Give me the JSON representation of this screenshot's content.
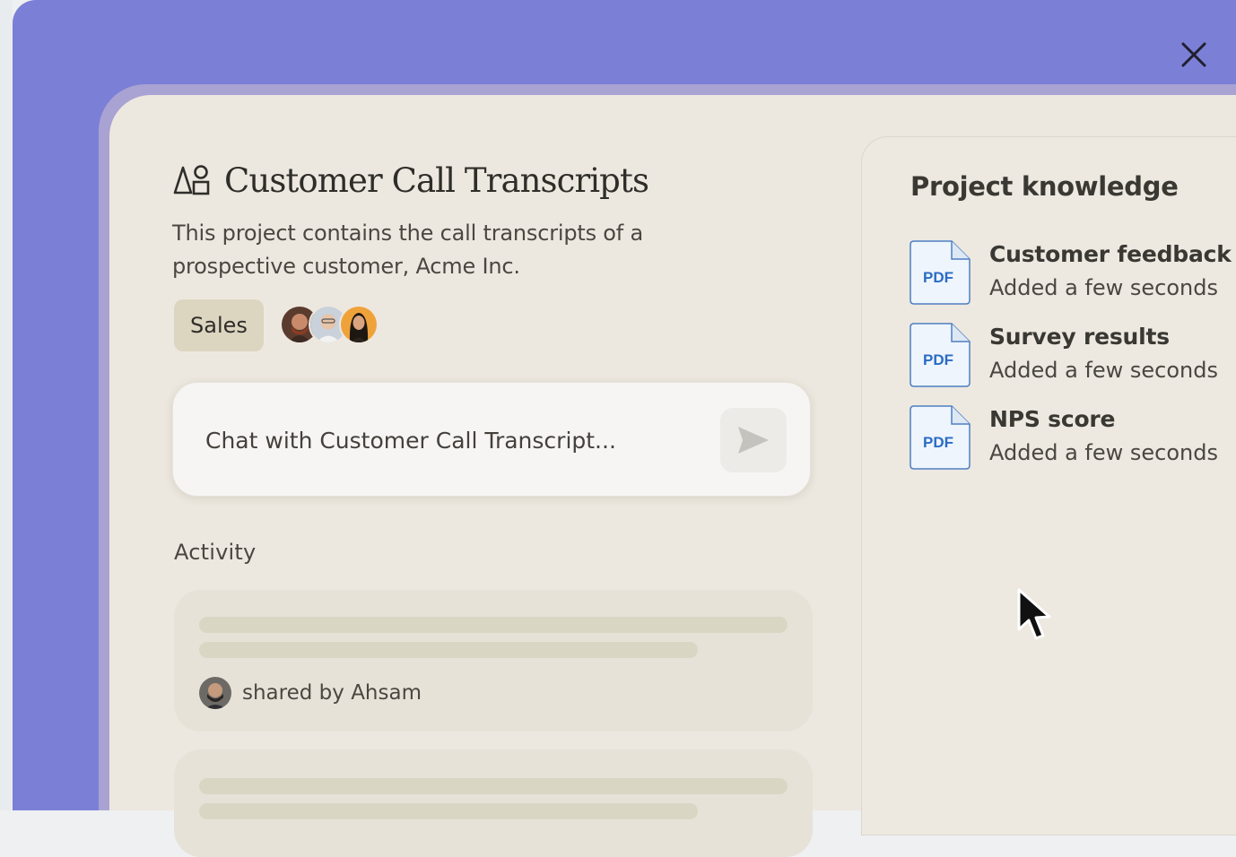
{
  "project": {
    "title": "Customer Call Transcripts",
    "description": "This project contains the call transcripts of a prospective customer, Acme Inc.",
    "tag": "Sales",
    "chat_placeholder": "Chat with Customer Call Transcript...",
    "activity_label": "Activity",
    "activity_items": [
      {
        "shared_by": "shared by Ahsam"
      }
    ]
  },
  "knowledge": {
    "title": "Project knowledge",
    "files": [
      {
        "icon_label": "PDF",
        "name": "Customer feedback t",
        "added": "Added a few seconds"
      },
      {
        "icon_label": "PDF",
        "name": "Survey results",
        "added": "Added a few seconds"
      },
      {
        "icon_label": "PDF",
        "name": "NPS score",
        "added": "Added a few seconds"
      }
    ]
  },
  "icons": {
    "title": "shapes-icon",
    "close": "close-icon",
    "send": "send-icon",
    "file": "pdf-file-icon"
  },
  "colors": {
    "backdrop": "#7b7fd6",
    "panel": "#ede8df",
    "tag": "#dcd5c0",
    "pdf_label": "#2b6cc4"
  }
}
